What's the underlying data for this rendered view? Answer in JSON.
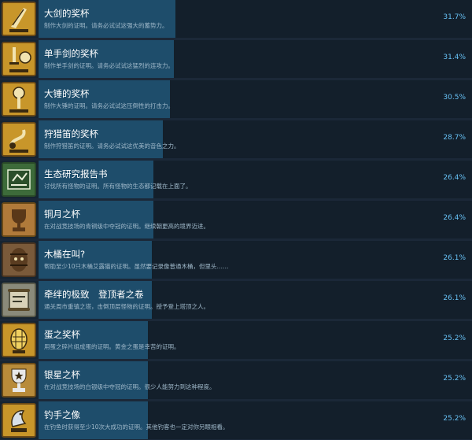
{
  "colors": {
    "background": "#1b2838",
    "progress_fill": "#1e4d6b",
    "percent_text": "#67c1f5",
    "gold_icon": "#d9a22b"
  },
  "achievements": [
    {
      "title": "大剑的奖杯",
      "desc": "制作大剑的证明。请务必试试这强大的蓄势力。",
      "percent": "31.7%",
      "value": 31.7,
      "icon": "greatsword-trophy-icon",
      "icon_bg": "#c8962a"
    },
    {
      "title": "单手剑的奖杯",
      "desc": "制作单手剑的证明。请务必试试这猛烈的连攻力。",
      "percent": "31.4%",
      "value": 31.4,
      "icon": "sword-shield-trophy-icon",
      "icon_bg": "#c8962a"
    },
    {
      "title": "大锤的奖杯",
      "desc": "制作大锤的证明。请务必试试这压倒性的打击力。",
      "percent": "30.5%",
      "value": 30.5,
      "icon": "hammer-trophy-icon",
      "icon_bg": "#c8962a"
    },
    {
      "title": "狩猎笛的奖杯",
      "desc": "制作狩猎笛的证明。请务必试试这优美的音色之力。",
      "percent": "28.7%",
      "value": 28.7,
      "icon": "hunting-horn-trophy-icon",
      "icon_bg": "#c8962a"
    },
    {
      "title": "生态研究报告书",
      "desc": "讨伐所有怪物的证明。所有怪物的生态都记载在上面了。",
      "percent": "26.4%",
      "value": 26.4,
      "icon": "research-report-icon",
      "icon_bg": "#3d6b3a"
    },
    {
      "title": "铜月之杯",
      "desc": "在对战竞技场的青铜级中夺冠的证明。继续朝更高的境界迈进。",
      "percent": "26.4%",
      "value": 26.4,
      "icon": "bronze-cup-icon",
      "icon_bg": "#b07a3a"
    },
    {
      "title": "木桶在叫?",
      "desc": "帮助至少10只木桶艾露猫的证明。虽然要记录像普通木桶，但里头……",
      "percent": "26.1%",
      "value": 26.1,
      "icon": "barrel-icon",
      "icon_bg": "#7a5a3a"
    },
    {
      "title": "牵绊的极致　登顶者之卷",
      "desc": "通关周市重镇之塔，击倒顶层怪物的证明。授予登上塔顶之人。",
      "percent": "26.1%",
      "value": 26.1,
      "icon": "scroll-icon",
      "icon_bg": "#8a8a7a"
    },
    {
      "title": "蛋之奖杯",
      "desc": "用蛋之碎片组成蛋的证明。黄金之蛋是幸苦的证明。",
      "percent": "25.2%",
      "value": 25.2,
      "icon": "golden-egg-icon",
      "icon_bg": "#c8962a"
    },
    {
      "title": "银星之杯",
      "desc": "在对战竞技场的白银级中夺冠的证明。很少人能努力到这种程度。",
      "percent": "25.2%",
      "value": 25.2,
      "icon": "silver-cup-icon",
      "icon_bg": "#b88b3a"
    },
    {
      "title": "钓手之像",
      "desc": "在钓鱼时获得至少10次大成功的证明。其他钓客也一定对你另眼相看。",
      "percent": "25.2%",
      "value": 25.2,
      "icon": "fish-statue-icon",
      "icon_bg": "#c8962a"
    }
  ]
}
